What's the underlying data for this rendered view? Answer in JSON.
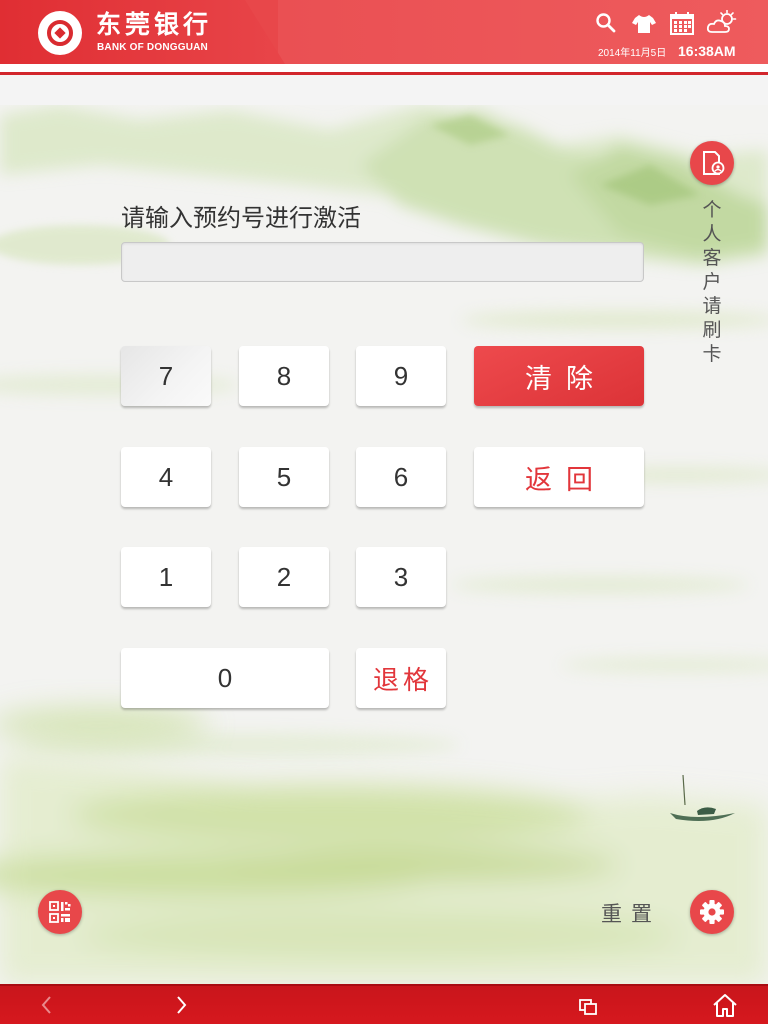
{
  "header": {
    "bank_name_cn": "东莞银行",
    "bank_name_en": "BANK OF DONGGUAN",
    "date": "2014年11月5日",
    "time": "16:38AM",
    "icons": [
      "search-icon",
      "shirt-icon",
      "calendar-icon",
      "weather-icon"
    ]
  },
  "form": {
    "prompt": "请输入预约号进行激活",
    "input_value": ""
  },
  "keypad": {
    "digits": [
      "7",
      "8",
      "9",
      "4",
      "5",
      "6",
      "1",
      "2",
      "3",
      "0"
    ],
    "clear_label": "清除",
    "back_label": "返回",
    "backspace_label": "退格"
  },
  "side": {
    "card_prompt": "个人客户请刷卡",
    "card_icon": "card-reader-icon"
  },
  "footer_actions": {
    "reset_label": "重置",
    "qr_icon": "qr-code-icon",
    "settings_icon": "gear-icon"
  },
  "bottom_nav": {
    "icons": [
      "back-arrow-icon",
      "forward-arrow-icon",
      "windows-icon",
      "home-icon"
    ]
  },
  "colors": {
    "brand_red": "#e8474a",
    "dark_red": "#d2262c",
    "accent_text": "#e2363b"
  }
}
